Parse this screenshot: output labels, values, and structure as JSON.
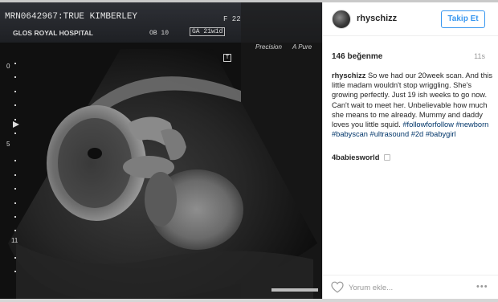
{
  "photo": {
    "line1_left": "MRN0642967:TRUE KIMBERLEY",
    "line1_right": "F 22",
    "line2_left": "GLOS ROYAL HOSPITAL",
    "line2_mid": "OB 10",
    "line2_right": "GA 21w1d",
    "precision": "Precision",
    "apure": "A Pure",
    "scale_0": "0",
    "scale_5": "5",
    "scale_11": "11",
    "marker_t": "T"
  },
  "post": {
    "username": "rhyschizz",
    "follow_label": "Takip Et",
    "likes": "146 beğenme",
    "time": "11s",
    "caption_user": "rhyschizz",
    "caption_text": " So we had our 20week scan. And this little madam wouldn't stop wriggling. She's growing perfectly. Just 19 ish weeks to go now. Can't wait to meet her. Unbelievable how much she means to me already. Mummy and daddy loves you little squid. ",
    "hashtags": "#followforfollow #newborn #babyscan #ultrasound #2d #babygirl",
    "commenter": "4babiesworld",
    "comment_placeholder": "Yorum ekle...",
    "more_label": "•••"
  },
  "icons": {
    "heart": "heart-icon",
    "more": "more-options-icon",
    "avatar": "avatar"
  },
  "colors": {
    "accent": "#3897f0",
    "hashtag": "#003569"
  }
}
